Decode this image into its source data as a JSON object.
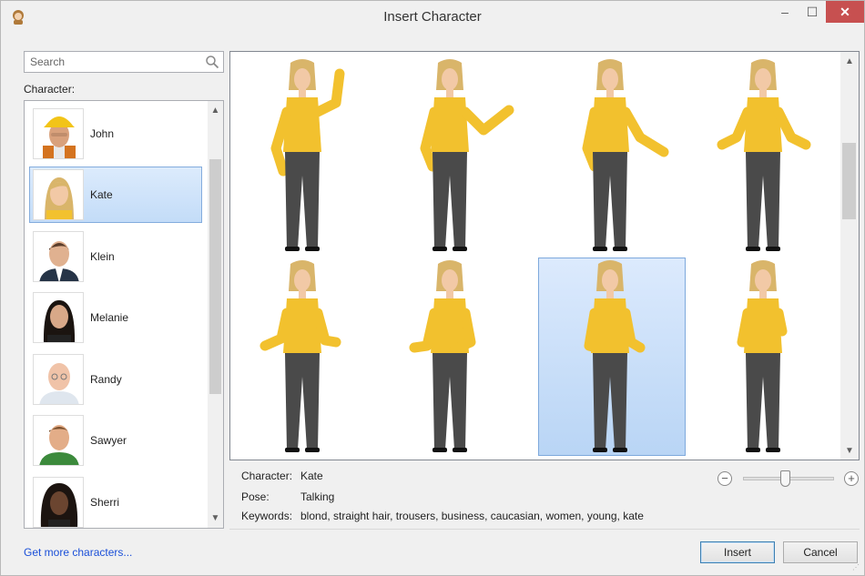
{
  "window": {
    "title": "Insert Character",
    "minimize": "–",
    "maximize": "☐",
    "close": "✕"
  },
  "search": {
    "placeholder": "Search"
  },
  "character_label": "Character:",
  "characters": [
    {
      "name": "John"
    },
    {
      "name": "Kate",
      "selected": true
    },
    {
      "name": "Klein"
    },
    {
      "name": "Melanie"
    },
    {
      "name": "Randy"
    },
    {
      "name": "Sawyer"
    },
    {
      "name": "Sherri"
    }
  ],
  "poses": [
    {
      "gesture": "point-up-right"
    },
    {
      "gesture": "point-right"
    },
    {
      "gesture": "point-down-right"
    },
    {
      "gesture": "shrug"
    },
    {
      "gesture": "open-hands"
    },
    {
      "gesture": "hands-gesture"
    },
    {
      "gesture": "talking",
      "selected": true
    },
    {
      "gesture": "thinking"
    }
  ],
  "info": {
    "character_key": "Character:",
    "character_value": "Kate",
    "pose_key": "Pose:",
    "pose_value": "Talking",
    "keywords_key": "Keywords:",
    "keywords_value": "blond, straight hair, trousers, business, caucasian, women, young, kate"
  },
  "zoom": {
    "minus": "−",
    "plus": "+",
    "level": 0.45
  },
  "footer": {
    "more_link": "Get more characters...",
    "insert": "Insert",
    "cancel": "Cancel"
  },
  "colors": {
    "selection": "#c3dcf8",
    "shirt": "#f2c12e",
    "trousers": "#4a4a4a",
    "close": "#c75050",
    "link": "#1a4fd8"
  }
}
